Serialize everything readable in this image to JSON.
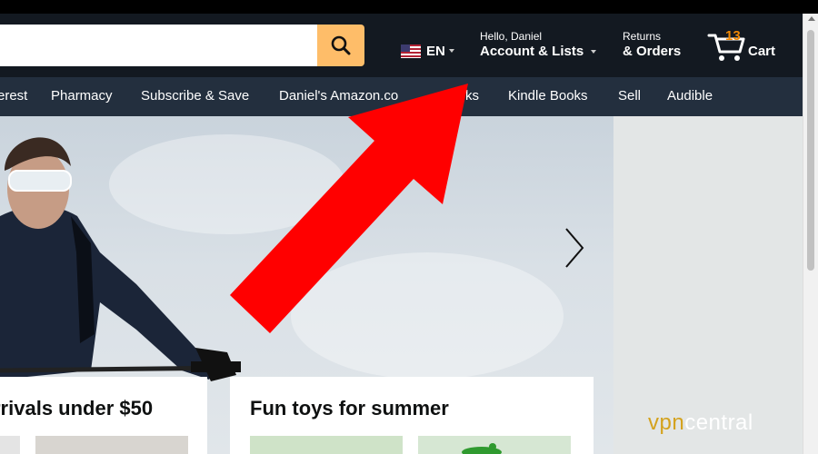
{
  "header": {
    "language": "EN",
    "account_greeting": "Hello, Daniel",
    "account_label": "Account & Lists",
    "returns_line1": "Returns",
    "returns_line2": "& Orders",
    "cart_count": "13",
    "cart_label": "Cart"
  },
  "nav": {
    "items": [
      "erest",
      "Pharmacy",
      "Subscribe & Save",
      "Daniel's Amazon.co",
      "ks",
      "Kindle Books",
      "Sell",
      "Audible"
    ]
  },
  "cards": [
    {
      "title": "rrivals under $50"
    },
    {
      "title": "Fun toys for summer"
    }
  ],
  "watermark": {
    "part1": "vpn",
    "part2": "central"
  },
  "colors": {
    "header_bg": "#131921",
    "nav_bg": "#232f3e",
    "search_button": "#febd69",
    "cart_count": "#f08804",
    "annotation_arrow": "#ff0000"
  },
  "icons": [
    "search-icon",
    "us-flag-icon",
    "cart-icon",
    "chevron-right-icon",
    "annotation-arrow"
  ]
}
